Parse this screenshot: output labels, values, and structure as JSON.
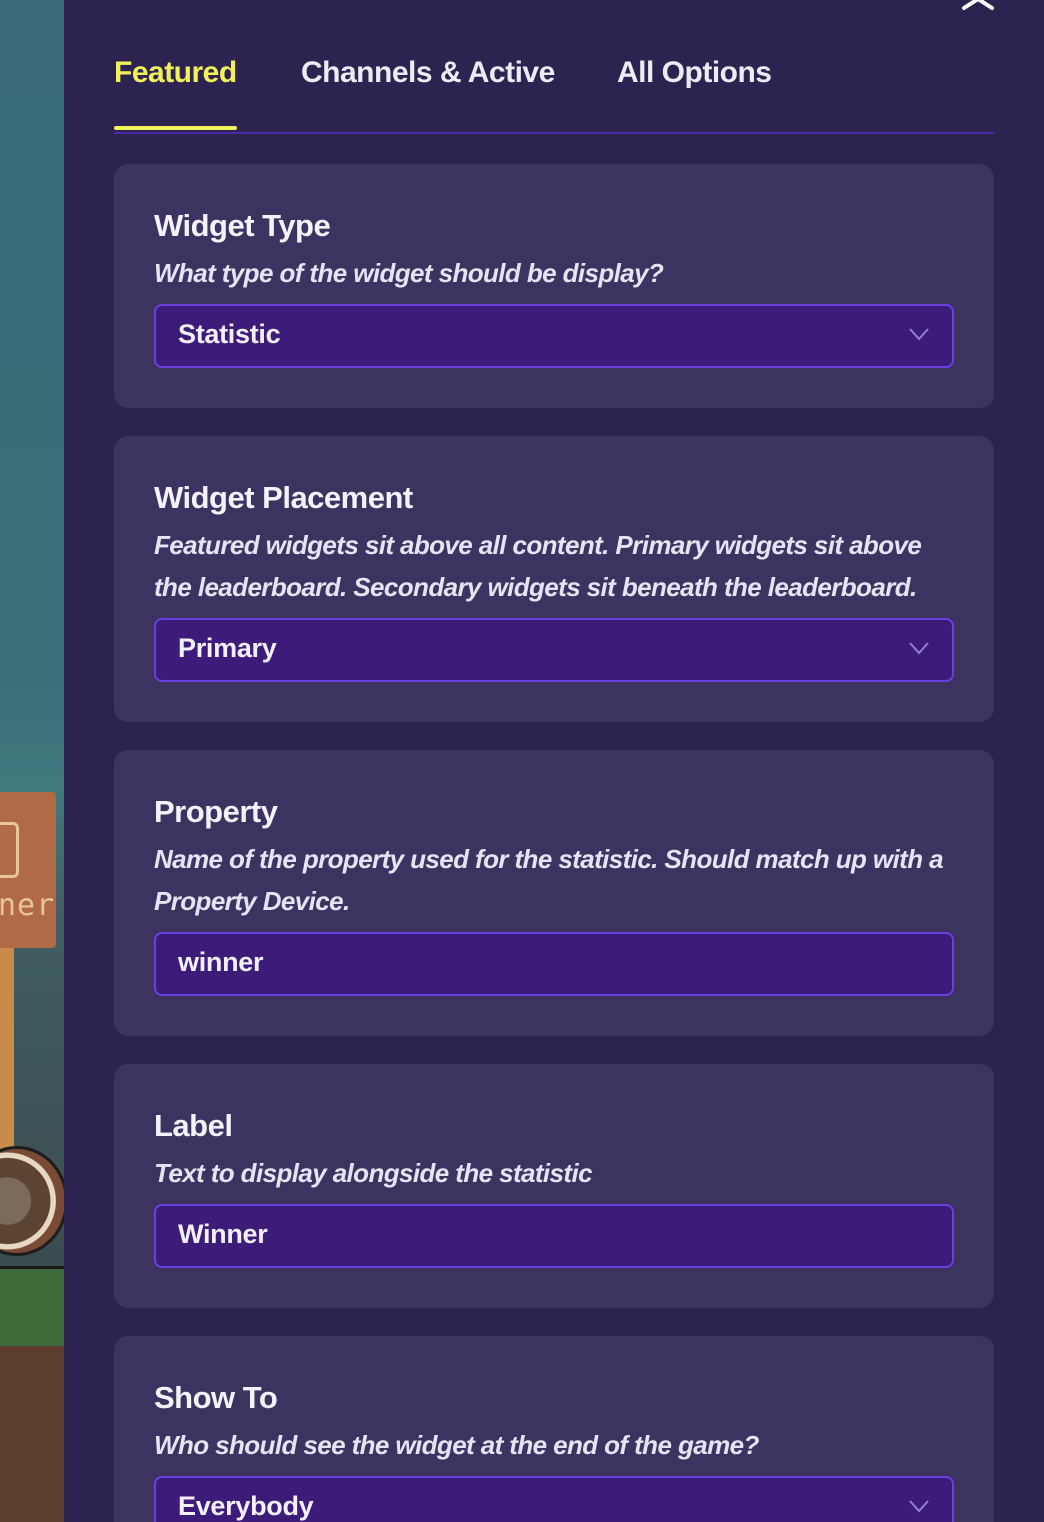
{
  "tabs": [
    {
      "label": "Featured",
      "active": true
    },
    {
      "label": "Channels & Active",
      "active": false
    },
    {
      "label": "All Options",
      "active": false
    }
  ],
  "background_scene": {
    "sign_text": "ner"
  },
  "cards": {
    "widget_type": {
      "title": "Widget Type",
      "description": "What type of the widget should be display?",
      "value": "Statistic",
      "control": "select"
    },
    "widget_placement": {
      "title": "Widget Placement",
      "description": "Featured widgets sit above all content. Primary widgets sit above the leaderboard. Secondary widgets sit beneath the leaderboard.",
      "value": "Primary",
      "control": "select"
    },
    "property": {
      "title": "Property",
      "description": "Name of the property used for the statistic. Should match up with a Property Device.",
      "value": "winner",
      "control": "text"
    },
    "label": {
      "title": "Label",
      "description": "Text to display alongside the statistic",
      "value": "Winner",
      "control": "text"
    },
    "show_to": {
      "title": "Show To",
      "description": "Who should see the widget at the end of the game?",
      "value": "Everybody",
      "control": "select"
    }
  },
  "colors": {
    "panel_bg": "#2d2351",
    "card_bg": "#3c3361",
    "field_bg": "#3d1c79",
    "field_border": "#6a40e0",
    "active_tab": "#f3f15a"
  },
  "icons": {
    "close": "close-icon",
    "dropdown": "chevron-down-icon"
  }
}
